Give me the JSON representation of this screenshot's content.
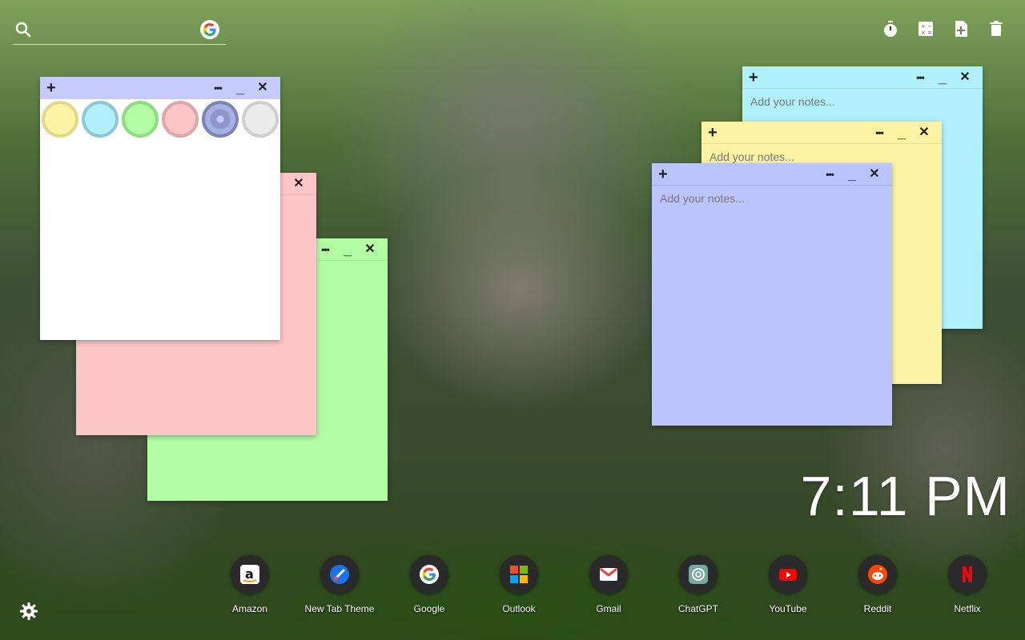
{
  "search": {
    "placeholder": ""
  },
  "top_icons": [
    "timer-icon",
    "calculator-icon",
    "add-note-icon",
    "trash-icon"
  ],
  "notes": {
    "placeholder": "Add your notes...",
    "plus": "+",
    "more": "•••",
    "minimize": "_",
    "close": "✕"
  },
  "swatch_colors": [
    "#fdf3a5",
    "#b0f0fc",
    "#b2fca4",
    "#fcc5c6",
    "#8d97c9",
    "#ebebeb"
  ],
  "clock": {
    "time": "7:11 PM"
  },
  "dock": [
    {
      "label": "Amazon"
    },
    {
      "label": "New Tab Theme"
    },
    {
      "label": "Google"
    },
    {
      "label": "Outlook"
    },
    {
      "label": "Gmail"
    },
    {
      "label": "ChatGPT"
    },
    {
      "label": "YouTube"
    },
    {
      "label": "Reddit"
    },
    {
      "label": "Netflix"
    }
  ]
}
